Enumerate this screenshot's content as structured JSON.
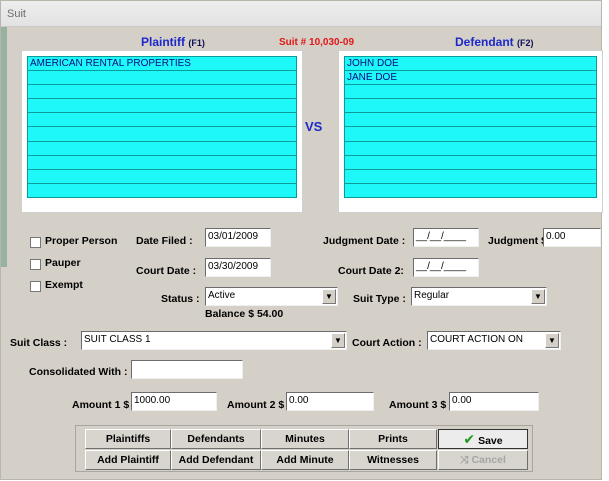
{
  "window": {
    "title": "Suit"
  },
  "header": {
    "plaintiff_label": "Plaintiff",
    "plaintiff_key": "(F1)",
    "suit_number": "Suit # 10,030-09",
    "defendant_label": "Defendant",
    "defendant_key": "(F2)",
    "vs": "VS"
  },
  "plaintiffs": [
    "AMERICAN RENTAL PROPERTIES",
    "",
    "",
    "",
    "",
    "",
    "",
    "",
    "",
    ""
  ],
  "defendants": [
    "JOHN DOE",
    "JANE DOE",
    "",
    "",
    "",
    "",
    "",
    "",
    "",
    ""
  ],
  "form": {
    "proper_person": "Proper Person",
    "pauper": "Pauper",
    "exempt": "Exempt",
    "date_filed_label": "Date Filed :",
    "date_filed": "03/01/2009",
    "court_date_label": "Court Date :",
    "court_date": "03/30/2009",
    "status_label": "Status :",
    "status": "Active",
    "balance": "Balance $  54.00",
    "judgment_date_label": "Judgment Date :",
    "judgment_date": "__/__/____",
    "judgment_amount_label": "Judgment $",
    "judgment_amount": "0.00",
    "court_date2_label": "Court Date 2:",
    "court_date2": "__/__/____",
    "suit_type_label": "Suit Type :",
    "suit_type": "Regular",
    "suit_class_label": "Suit Class :",
    "suit_class": "SUIT CLASS 1",
    "court_action_label": "Court Action :",
    "court_action": "COURT ACTION ON",
    "consolidated_label": "Consolidated With :",
    "consolidated": "",
    "amount1_label": "Amount 1 $",
    "amount1": "1000.00",
    "amount2_label": "Amount 2 $",
    "amount2": "0.00",
    "amount3_label": "Amount 3 $",
    "amount3": "0.00"
  },
  "buttons": {
    "plaintiffs": "Plaintiffs",
    "defendants": "Defendants",
    "minutes": "Minutes",
    "prints": "Prints",
    "save": "Save",
    "add_plaintiff": "Add Plaintiff",
    "add_defendant": "Add Defendant",
    "add_minute": "Add Minute",
    "witnesses": "Witnesses",
    "cancel": "Cancel"
  }
}
